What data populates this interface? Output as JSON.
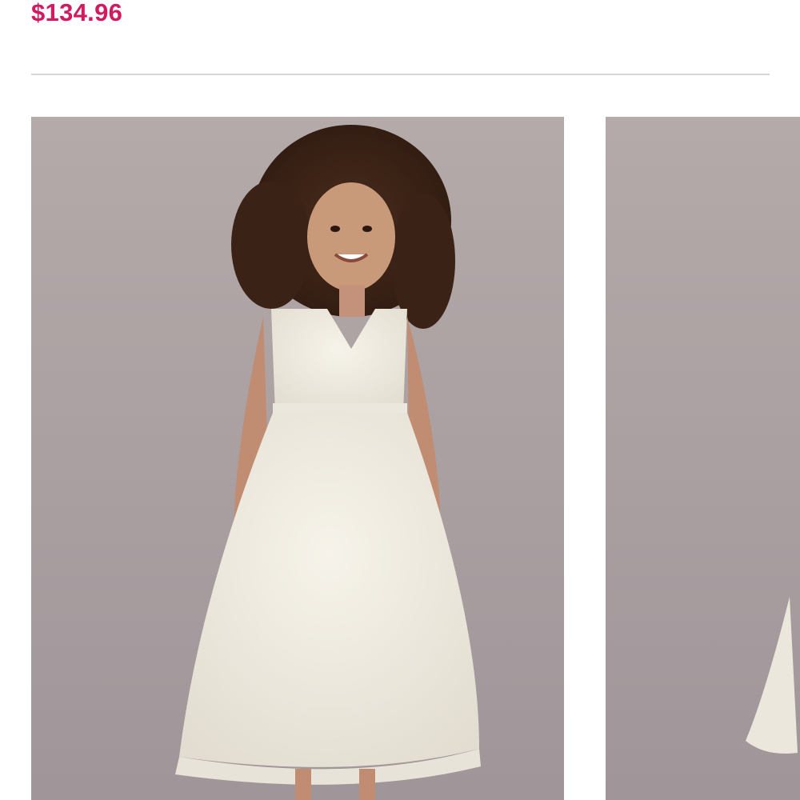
{
  "product": {
    "price": "$134.96"
  },
  "colors": {
    "price": "#d11a5f",
    "divider": "#d6d6d6",
    "photo_background": "#a99f9e"
  },
  "gallery": {
    "images": [
      {
        "name": "product-image-main"
      },
      {
        "name": "product-image-next"
      }
    ]
  }
}
